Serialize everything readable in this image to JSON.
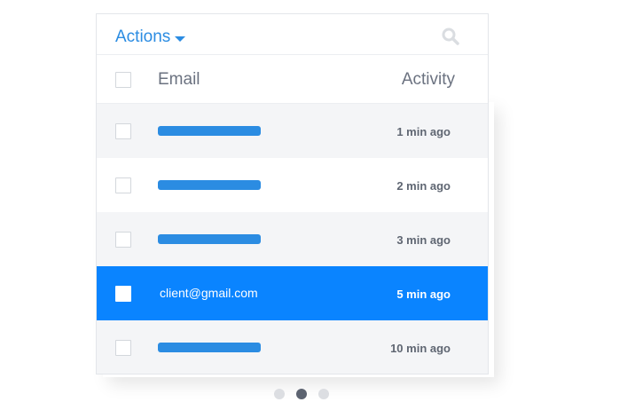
{
  "toolbar": {
    "actions_label": "Actions",
    "actions_caret_icon": "caret-down-icon",
    "search_icon": "search-icon"
  },
  "table": {
    "columns": [
      "Email",
      "Activity"
    ],
    "rows": [
      {
        "email": "",
        "email_redacted": true,
        "activity": "1 min ago",
        "selected": false
      },
      {
        "email": "",
        "email_redacted": true,
        "activity": "2 min ago",
        "selected": false
      },
      {
        "email": "",
        "email_redacted": true,
        "activity": "3 min ago",
        "selected": false
      },
      {
        "email": "client@gmail.com",
        "email_redacted": false,
        "activity": "5 min ago",
        "selected": true
      },
      {
        "email": "",
        "email_redacted": true,
        "activity": "10 min ago",
        "selected": false
      }
    ]
  },
  "pagination": {
    "page_count": 3,
    "current_page": 2
  },
  "colors": {
    "accent": "#2b8ce2",
    "selected_row": "#0a84ff",
    "text_muted": "#6b7280",
    "row_alt": "#f4f5f7"
  }
}
